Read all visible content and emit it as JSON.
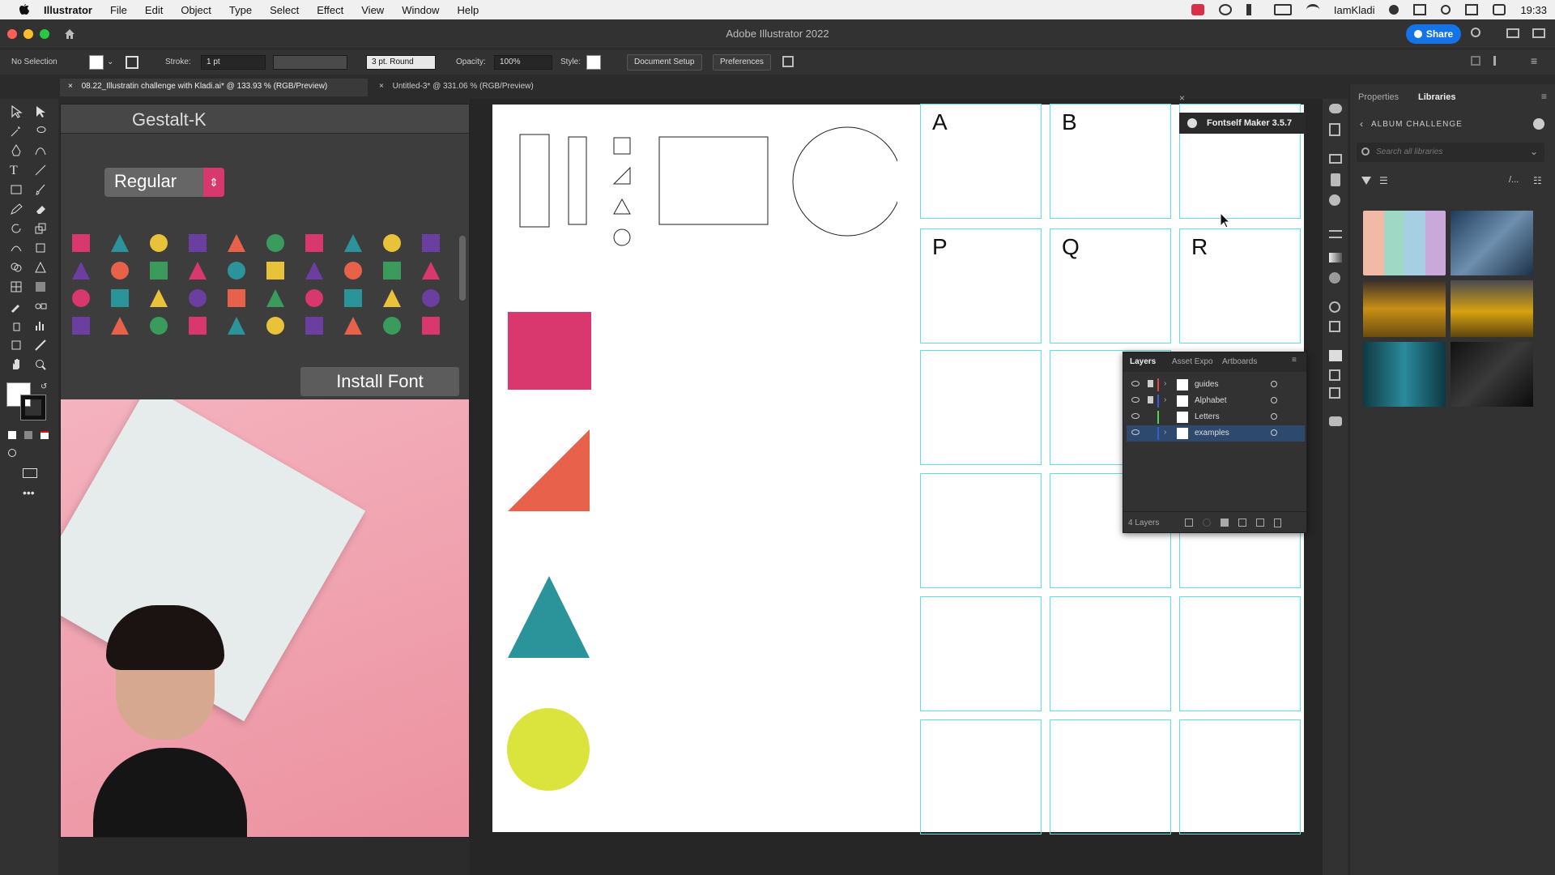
{
  "menubar": {
    "app": "Illustrator",
    "items": [
      "File",
      "Edit",
      "Object",
      "Type",
      "Select",
      "Effect",
      "View",
      "Window",
      "Help"
    ],
    "user": "IamKladi",
    "time": "19:33"
  },
  "window": {
    "title": "Adobe Illustrator 2022",
    "share": "Share"
  },
  "controlbar": {
    "selection": "No Selection",
    "stroke_label": "Stroke:",
    "stroke_value": "1 pt",
    "brush": "3 pt. Round",
    "opacity_label": "Opacity:",
    "opacity_value": "100%",
    "style_label": "Style:",
    "doc_setup": "Document Setup",
    "preferences": "Preferences"
  },
  "tabs": [
    "08.22_Illustratin challenge with Kladi.ai* @ 133.93 % (RGB/Preview)",
    "Untitled-3* @ 331.06 % (RGB/Preview)"
  ],
  "font_preview": {
    "font_name": "Gestalt-K",
    "style": "Regular",
    "install": "Install Font"
  },
  "artboard": {
    "letters": [
      "A",
      "B",
      "P",
      "Q",
      "R"
    ],
    "colors": {
      "pink": "#d9386f",
      "orange": "#e8624b",
      "teal": "#2a949a",
      "yellow": "#dbe43c",
      "guide": "#5ee0e6"
    }
  },
  "fontself": "Fontself Maker 3.5.7",
  "layers_panel": {
    "tabs": [
      "Layers",
      "Asset Expo",
      "Artboards"
    ],
    "layers": [
      {
        "name": "guides",
        "color": "#e04444"
      },
      {
        "name": "Alphabet",
        "color": "#3a5bd9"
      },
      {
        "name": "Letters",
        "color": "#4bd94b"
      },
      {
        "name": "examples",
        "color": "#3a5bd9"
      }
    ],
    "count": "4 Layers"
  },
  "libraries": {
    "tabs": [
      "Properties",
      "Libraries"
    ],
    "library_name": "ALBUM CHALLENGE",
    "search_placeholder": "Search all libraries"
  }
}
